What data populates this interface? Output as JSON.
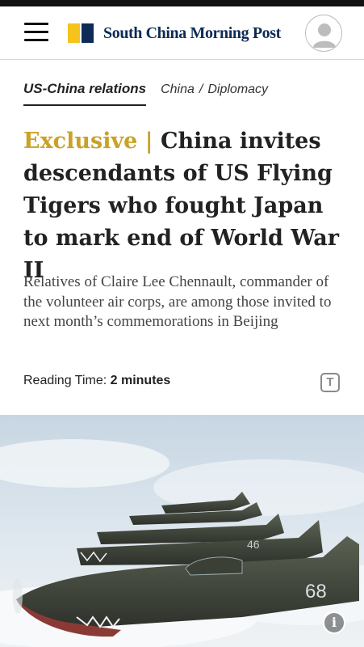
{
  "header": {
    "logo_text": "South China Morning Post",
    "brand_colors": {
      "yellow": "#f6c21c",
      "navy": "#0d2b55"
    },
    "menu_icon": "hamburger-menu-icon",
    "avatar_icon": "user-avatar-icon"
  },
  "breadcrumbs": {
    "primary": "US-China relations",
    "section": "China",
    "separator": "/",
    "subsection": "Diplomacy"
  },
  "article": {
    "label": "Exclusive",
    "label_separator": "|",
    "label_color": "#c9a227",
    "headline": "China invites descendants of US Flying Tigers who fought Japan to mark end of World War II",
    "summary": "Relatives of Claire Lee Chennault, commander of the volunteer air corps, are among those invited to next month’s commemorations in Beijing",
    "reading_time_label": "Reading Time:",
    "reading_time_value": "2 minutes",
    "text_size_icon": "text-size-icon",
    "text_size_glyph": "T"
  },
  "hero": {
    "image_subject": "flying-tigers-p40-aircraft",
    "aircraft_number": "68",
    "aircraft_number_2": "46",
    "info_icon": "info-icon",
    "info_glyph": "i"
  }
}
